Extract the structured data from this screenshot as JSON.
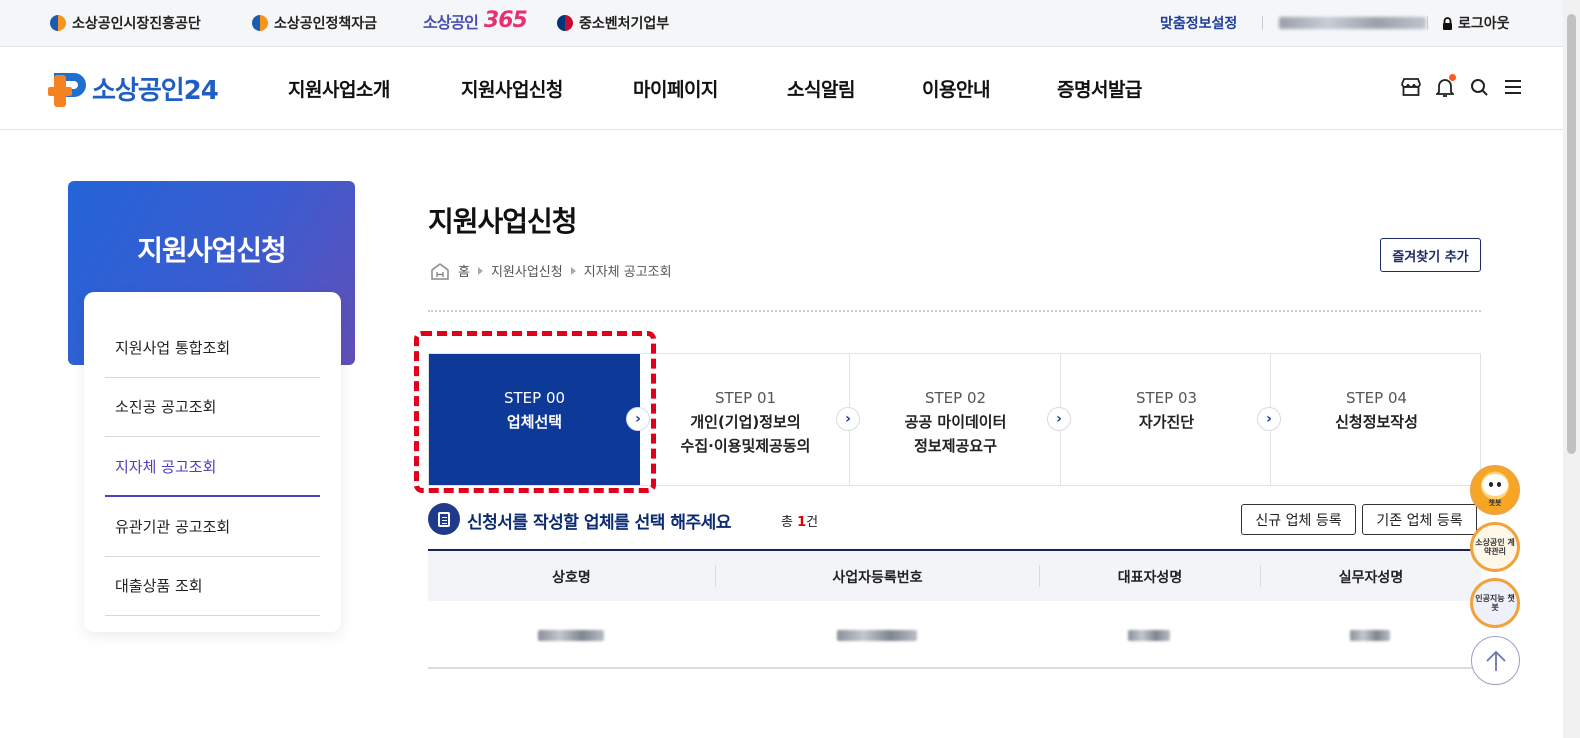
{
  "utility_bar": {
    "left_links": [
      {
        "label": "소상공인시장진흥공단",
        "icon": "semas-logo-icon"
      },
      {
        "label": "소상공인정책자금",
        "icon": "semas-logo-icon"
      },
      {
        "label": "소상공인",
        "label_suffix": "365"
      },
      {
        "label": "중소벤처기업부",
        "icon": "taegeuk-icon"
      }
    ],
    "custom_info": "맞춤정보설정",
    "logout": "로그아웃"
  },
  "header": {
    "brand": "소상공인24",
    "nav": [
      "지원사업소개",
      "지원사업신청",
      "마이페이지",
      "소식알림",
      "이용안내",
      "증명서발급"
    ],
    "icons": [
      "store-icon",
      "bell-icon",
      "search-icon",
      "menu-icon"
    ]
  },
  "sidebar": {
    "title": "지원사업신청",
    "items": [
      {
        "label": "지원사업 통합조회",
        "active": false
      },
      {
        "label": "소진공 공고조회",
        "active": false
      },
      {
        "label": "지자체 공고조회",
        "active": true
      },
      {
        "label": "유관기관 공고조회",
        "active": false
      },
      {
        "label": "대출상품 조회",
        "active": false
      }
    ]
  },
  "main": {
    "title": "지원사업신청",
    "breadcrumb": [
      "홈",
      "지원사업신청",
      "지자체 공고조회"
    ],
    "favorite_button": "즐겨찾기 추가",
    "steps": [
      {
        "no": "STEP 00",
        "label_1": "업체선택",
        "label_2": "",
        "active": true
      },
      {
        "no": "STEP 01",
        "label_1": "개인(기업)정보의",
        "label_2": "수집·이용및제공동의",
        "active": false
      },
      {
        "no": "STEP 02",
        "label_1": "공공 마이데이터",
        "label_2": "정보제공요구",
        "active": false
      },
      {
        "no": "STEP 03",
        "label_1": "자가진단",
        "label_2": "",
        "active": false
      },
      {
        "no": "STEP 04",
        "label_1": "신청정보작성",
        "label_2": "",
        "active": false
      }
    ],
    "section": {
      "title": "신청서를 작성할 업체를 선택 해주세요",
      "count_prefix": "총 ",
      "count": "1",
      "count_suffix": "건",
      "new_button": "신규 업체 등록",
      "existing_button": "기존 업체 등록"
    },
    "table": {
      "headers": [
        "상호명",
        "사업자등록번호",
        "대표자성명",
        "실무자성명"
      ],
      "rows_note_blurred": true
    }
  },
  "floating": {
    "chatbot_caption": "챗봇",
    "contract_caption": "소상공인 계약관리",
    "ai_caption": "인공지능 챗봇"
  },
  "colors": {
    "accent_navy": "#0d3a99",
    "highlight_red": "#e0001b",
    "sidebar_active": "#4b3fc2"
  }
}
